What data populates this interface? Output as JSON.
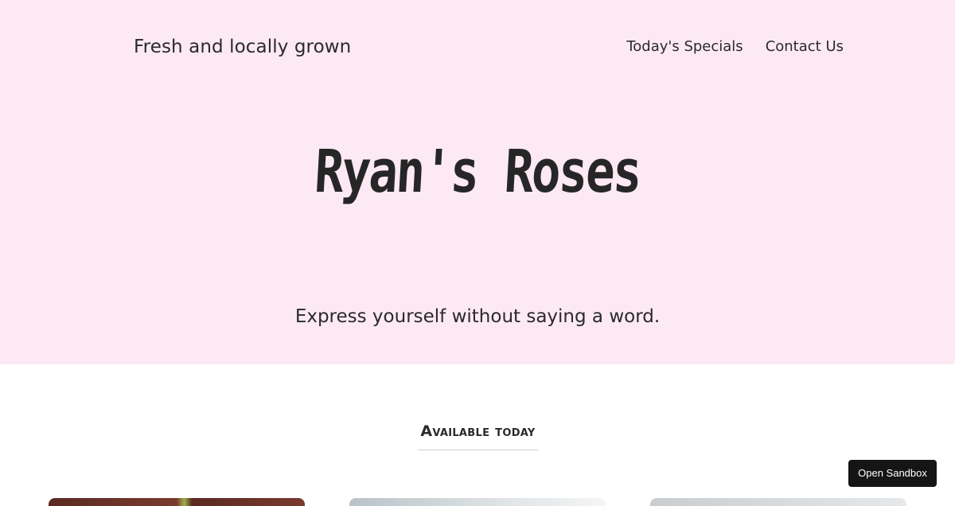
{
  "header": {
    "tagline": "Fresh and locally grown",
    "nav": [
      {
        "label": "Today's Specials"
      },
      {
        "label": "Contact Us"
      }
    ]
  },
  "hero": {
    "title": "Ryan's Roses",
    "subtitle": "Express yourself without saying a word."
  },
  "section": {
    "title": "Available today"
  },
  "sandbox": {
    "label": "Open Sandbox"
  },
  "colors": {
    "hero_bg": "#fde9f4",
    "text": "#2a2a2a",
    "sandbox_bg": "#151515"
  }
}
